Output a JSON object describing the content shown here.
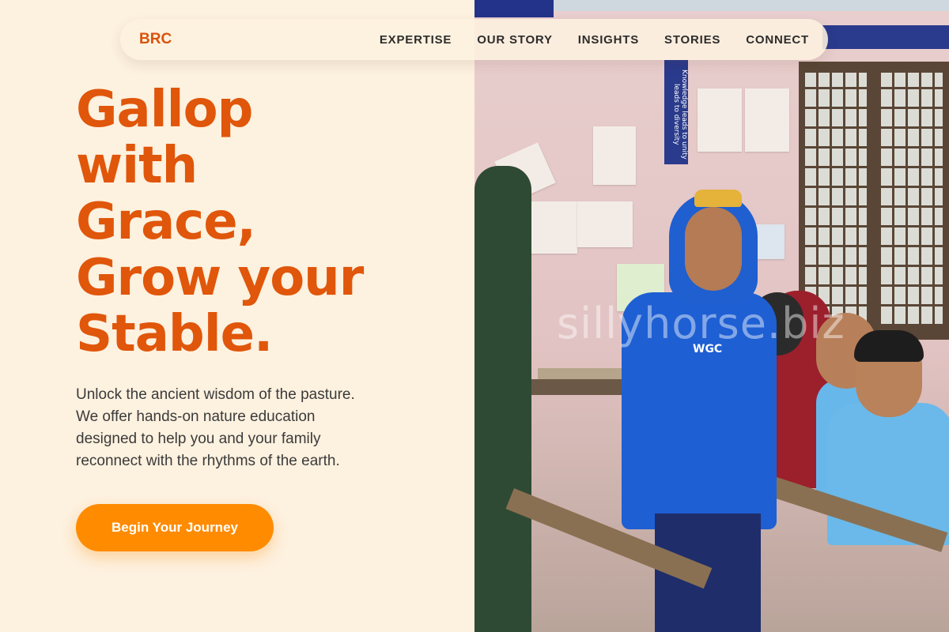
{
  "brand": {
    "logo": "BRC",
    "accent_color": "#e0560a",
    "cta_color": "#ff8b00",
    "background": "#fdf1df"
  },
  "nav": {
    "links": [
      "EXPERTISE",
      "OUR STORY",
      "INSIGHTS",
      "STORIES",
      "CONNECT"
    ]
  },
  "hero": {
    "title_lines": [
      "Gallop",
      "with",
      "Grace,",
      "Grow your",
      "Stable."
    ],
    "subtitle_lines": [
      "Unlock the ancient wisdom of the pasture.",
      "We offer hands-on nature education",
      "designed to help you and your family",
      "reconnect with the rhythms of the earth."
    ],
    "cta_label": "Begin Your Journey"
  },
  "photo": {
    "watermark": "sillyhorse.biz",
    "banner_text": "Knowledge leads to unity leads to diversity",
    "hoodie_logo": "WGC"
  }
}
